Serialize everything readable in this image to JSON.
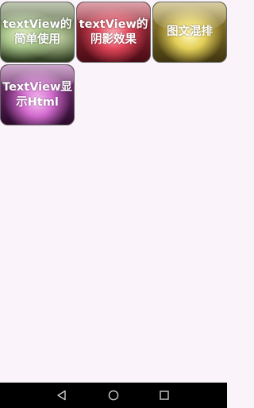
{
  "tiles": [
    {
      "label": "textView的简单使用",
      "color": "#5d6e48"
    },
    {
      "label": "textView的阴影效果",
      "color": "#c83a4c"
    },
    {
      "label": "图文混排",
      "color": "#c9b244"
    },
    {
      "label": "TextView显示Html",
      "color": "#b24fae"
    }
  ],
  "navbar": {
    "back_icon": "back-triangle-icon",
    "home_icon": "home-circle-icon",
    "recents_icon": "recents-square-icon"
  },
  "colors": {
    "background": "#faf4fa",
    "navbar": "#000000",
    "nav_icon": "#cccccc"
  }
}
